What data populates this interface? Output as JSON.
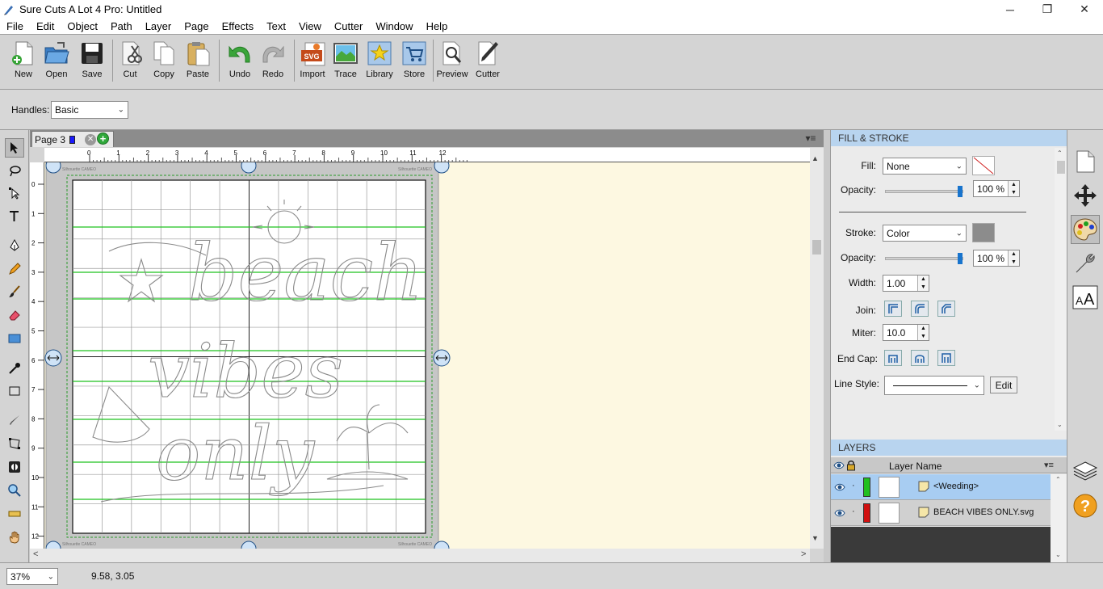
{
  "window": {
    "title": "Sure Cuts A Lot 4 Pro: Untitled",
    "buttons": {
      "minimize": "─",
      "maximize": "❐",
      "close": "✕"
    }
  },
  "menu": [
    "File",
    "Edit",
    "Object",
    "Path",
    "Layer",
    "Page",
    "Effects",
    "Text",
    "View",
    "Cutter",
    "Window",
    "Help"
  ],
  "toolbar": {
    "new": "New",
    "open": "Open",
    "save": "Save",
    "cut": "Cut",
    "copy": "Copy",
    "paste": "Paste",
    "undo": "Undo",
    "redo": "Redo",
    "import": "Import",
    "trace": "Trace",
    "library": "Library",
    "store": "Store",
    "preview": "Preview",
    "cutter": "Cutter"
  },
  "options": {
    "handles_label": "Handles:",
    "handles_value": "Basic"
  },
  "page_tab": {
    "label": "Page 3",
    "close": "✕",
    "add": "+",
    "menu": "▾≡"
  },
  "ruler": {
    "h_ticks": [
      "0",
      "1",
      "2",
      "3",
      "4",
      "5",
      "6",
      "7",
      "8",
      "9",
      "10",
      "11",
      "12"
    ],
    "v_ticks": [
      "0",
      "1",
      "2",
      "3",
      "4",
      "5",
      "6",
      "7",
      "8",
      "9",
      "10",
      "11",
      "12"
    ]
  },
  "mat": {
    "brand": "Silhouette CAMEO"
  },
  "artwork": {
    "words": [
      "beach",
      "vibes",
      "only"
    ]
  },
  "fill_stroke": {
    "title": "FILL & STROKE",
    "fill_label": "Fill:",
    "fill_value": "None",
    "opacity_label": "Opacity:",
    "fill_opacity": "100 %",
    "fill_opacity_level": 100,
    "stroke_label": "Stroke:",
    "stroke_value": "Color",
    "stroke_color": "#8c8c8c",
    "stroke_opacity": "100 %",
    "stroke_opacity_level": 100,
    "width_label": "Width:",
    "width_value": "1.00",
    "join_label": "Join:",
    "miter_label": "Miter:",
    "miter_value": "10.0",
    "endcap_label": "End Cap:",
    "linestyle_label": "Line Style:",
    "edit_label": "Edit"
  },
  "layers": {
    "title": "LAYERS",
    "column": "Layer Name",
    "rows": [
      {
        "name": "<Weeding>",
        "color": "#20c020",
        "selected": true
      },
      {
        "name": "BEACH VIBES ONLY.svg",
        "color": "#d01010",
        "selected": false
      }
    ]
  },
  "status": {
    "zoom": "37%",
    "coords": "9.58, 3.05"
  }
}
